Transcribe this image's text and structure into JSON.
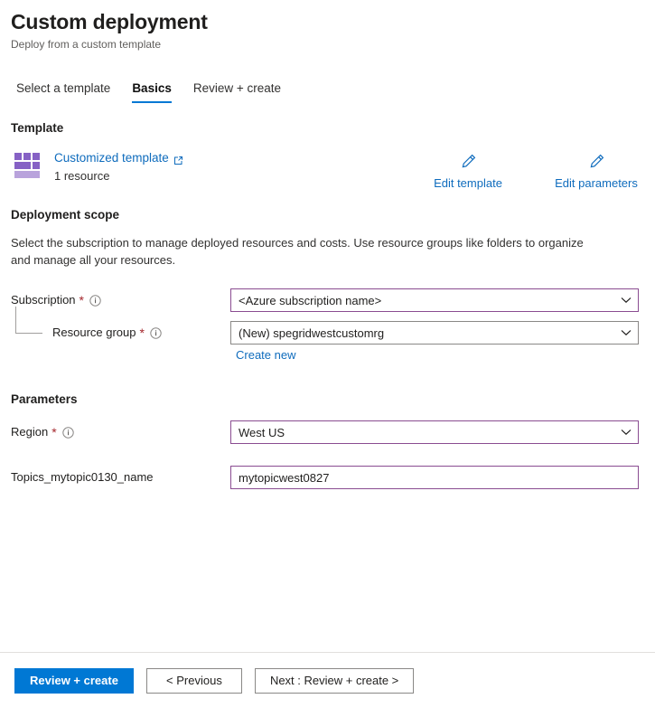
{
  "header": {
    "title": "Custom deployment",
    "subtitle": "Deploy from a custom template"
  },
  "tabs": [
    {
      "label": "Select a template",
      "active": false
    },
    {
      "label": "Basics",
      "active": true
    },
    {
      "label": "Review + create",
      "active": false
    }
  ],
  "template_section": {
    "heading": "Template",
    "icon": "template-blocks-icon",
    "link_label": "Customized template",
    "link_external_icon": "external-link-icon",
    "resource_count": "1 resource",
    "actions": [
      {
        "label": "Edit template",
        "icon": "pencil-icon"
      },
      {
        "label": "Edit parameters",
        "icon": "pencil-icon"
      }
    ]
  },
  "deployment_scope": {
    "heading": "Deployment scope",
    "description": "Select the subscription to manage deployed resources and costs. Use resource groups like folders to organize and manage all your resources.",
    "fields": [
      {
        "label": "Subscription",
        "required": "*",
        "info_icon": "info-icon",
        "control": "dropdown",
        "value": "<Azure subscription name>",
        "highlighted_value": "<Azure subscription",
        "highlight_tail": " name>",
        "focused": true,
        "chevron_icon": "chevron-down-icon"
      },
      {
        "label": "Resource group",
        "required": "*",
        "info_icon": "info-icon",
        "control": "dropdown",
        "value": "(New) spegridwestcustomrg",
        "focused": false,
        "chevron_icon": "chevron-down-icon",
        "sublink": "Create new"
      }
    ]
  },
  "parameters_section": {
    "heading": "Parameters",
    "fields": [
      {
        "label": "Region",
        "required": "*",
        "info_icon": "info-icon",
        "control": "dropdown",
        "value": "West US",
        "focused": true,
        "chevron_icon": "chevron-down-icon"
      },
      {
        "label": "Topics_mytopic0130_name",
        "required": "",
        "control": "textbox",
        "value": "mytopicwest0827",
        "placeholder": "",
        "focused": true
      }
    ]
  },
  "footer": {
    "buttons": [
      {
        "label": "Review + create",
        "style": "primary"
      },
      {
        "label": "< Previous",
        "style": "secondary"
      },
      {
        "label": "Next : Review + create >",
        "style": "secondary-wide"
      }
    ]
  },
  "colors": {
    "accent_blue": "#0078d4",
    "link_blue": "#0f6cbd",
    "focus_purple": "#8a4c91",
    "required_red": "#a4262c",
    "template_purple": "#8661c5",
    "template_purple_light": "#b9a3dc",
    "border_gray": "#8a8886"
  }
}
